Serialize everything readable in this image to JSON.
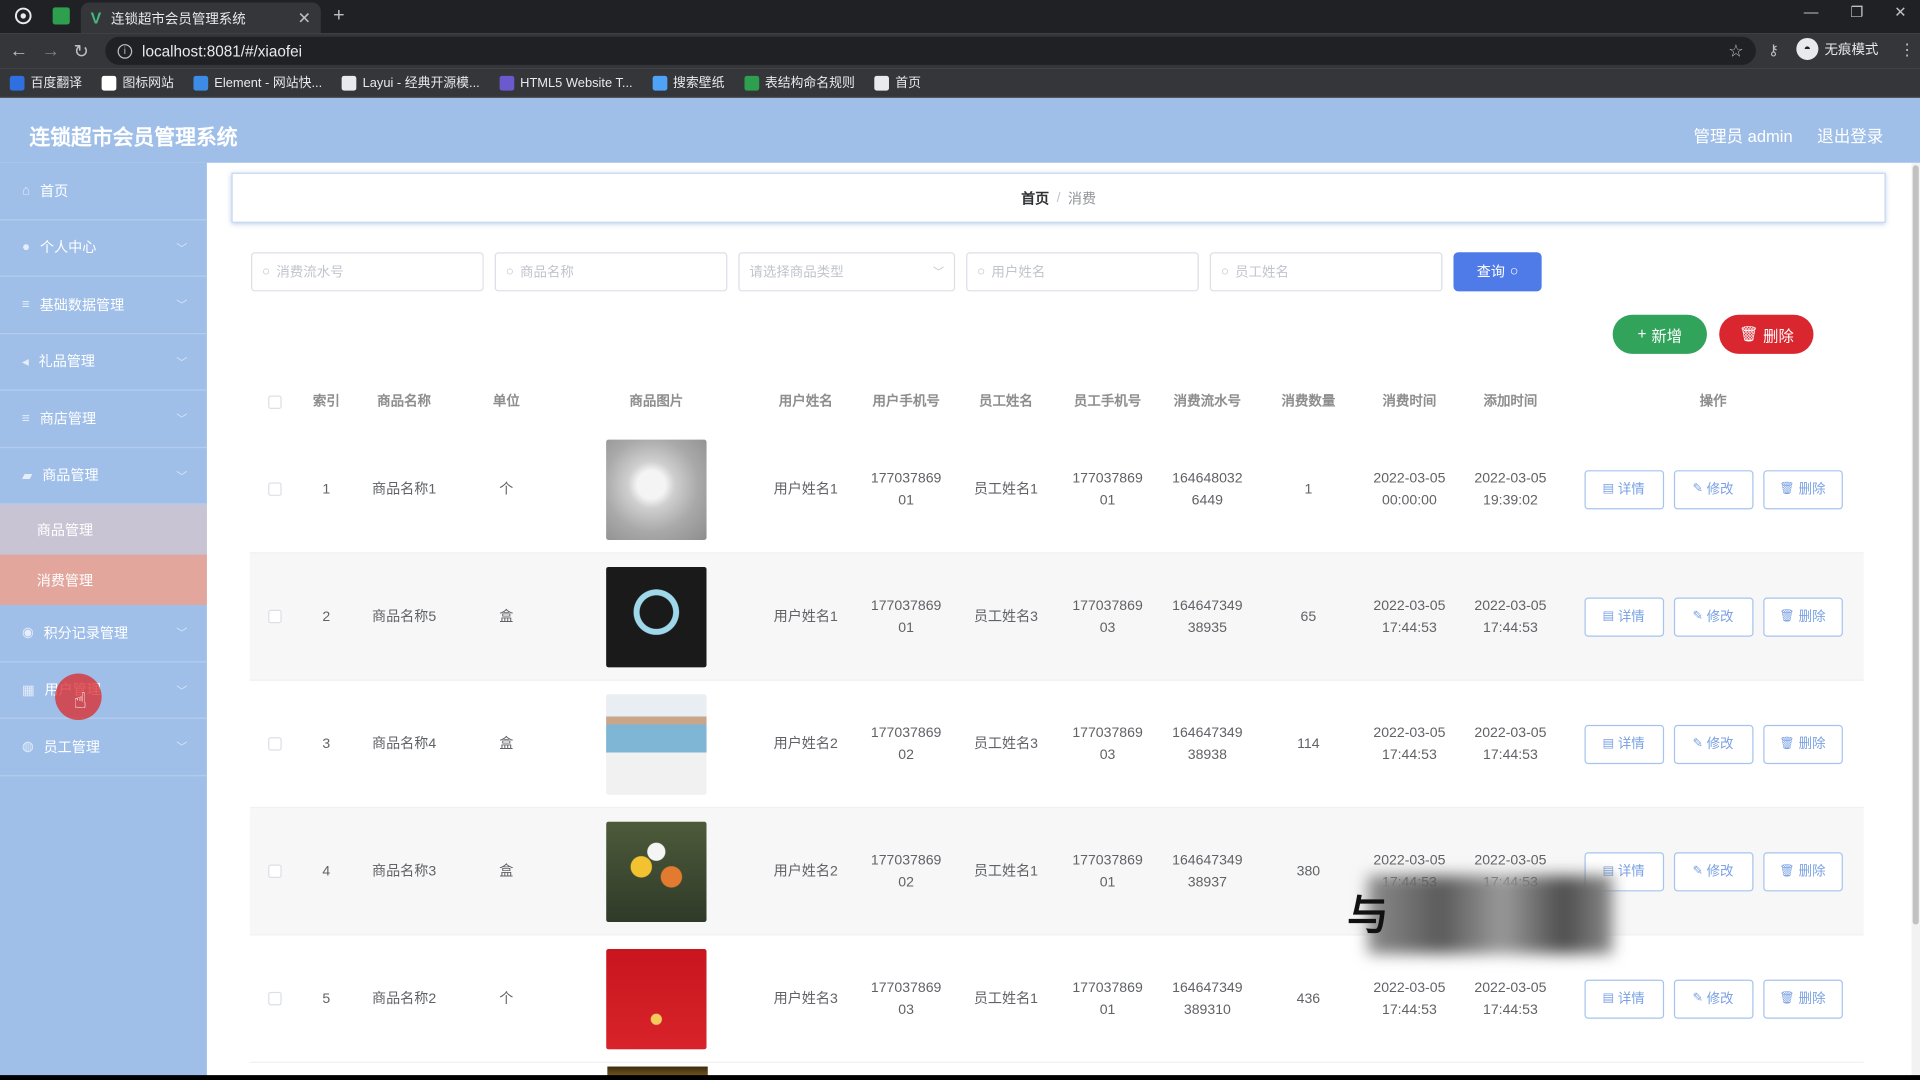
{
  "browser": {
    "tab_title": "连锁超市会员管理系统",
    "url": "localhost:8081/#/xiaofei",
    "incognito_label": "无痕模式",
    "bookmarks": [
      {
        "label": "百度翻译",
        "color": "#2f6fe0"
      },
      {
        "label": "图标网站",
        "color": "#ffffff"
      },
      {
        "label": "Element - 网站快...",
        "color": "#3c8ce7"
      },
      {
        "label": "Layui - 经典开源模...",
        "color": "#e8eaed"
      },
      {
        "label": "HTML5 Website T...",
        "color": "#6a5acd"
      },
      {
        "label": "搜索壁纸",
        "color": "#4fa3f7"
      },
      {
        "label": "表结构命名规则",
        "color": "#2e9e4f"
      },
      {
        "label": "首页",
        "color": "#e8eaed"
      }
    ]
  },
  "header": {
    "brand": "连锁超市会员管理系统",
    "admin": "管理员 admin",
    "logout": "退出登录"
  },
  "sidebar": {
    "items": [
      {
        "label": "首页",
        "icon": "home-icon",
        "has_arrow": false
      },
      {
        "label": "个人中心",
        "icon": "user-icon",
        "has_arrow": true
      },
      {
        "label": "基础数据管理",
        "icon": "list-icon",
        "has_arrow": true
      },
      {
        "label": "礼品管理",
        "icon": "gift-icon",
        "has_arrow": true
      },
      {
        "label": "商店管理",
        "icon": "list-icon",
        "has_arrow": true
      },
      {
        "label": "商品管理",
        "icon": "box-icon",
        "has_arrow": true
      }
    ],
    "sub_items": [
      {
        "label": "商品管理",
        "active": false
      },
      {
        "label": "消费管理",
        "active": true
      }
    ],
    "items_after": [
      {
        "label": "积分记录管理",
        "icon": "medal-icon",
        "has_arrow": true
      },
      {
        "label": "用户管理",
        "icon": "grid-icon",
        "has_arrow": true
      },
      {
        "label": "员工管理",
        "icon": "circle-icon",
        "has_arrow": true
      }
    ]
  },
  "breadcrumb": {
    "home": "首页",
    "sep": "/",
    "current": "消费"
  },
  "search": {
    "serial_placeholder": "消费流水号",
    "product_placeholder": "商品名称",
    "type_placeholder": "请选择商品类型",
    "user_placeholder": "用户姓名",
    "employee_placeholder": "员工姓名",
    "query_label": "查询"
  },
  "actions": {
    "add_label": "新增",
    "delete_label": "删除"
  },
  "table": {
    "headers": {
      "index": "索引",
      "name": "商品名称",
      "unit": "单位",
      "image": "商品图片",
      "uname": "用户姓名",
      "uphone": "用户手机号",
      "ename": "员工姓名",
      "ephone": "员工手机号",
      "serial": "消费流水号",
      "qty": "消费数量",
      "time": "消费时间",
      "add": "添加时间",
      "ops": "操作"
    },
    "op_labels": {
      "detail": "详情",
      "edit": "修改",
      "delete": "删除"
    },
    "rows": [
      {
        "index": "1",
        "name": "商品名称1",
        "unit": "个",
        "img": "img-silver",
        "uname": "用户姓名1",
        "uphone": [
          "177037869",
          "01"
        ],
        "ename": "员工姓名1",
        "ephone": [
          "177037869",
          "01"
        ],
        "serial": [
          "164648032",
          "6449"
        ],
        "qty": "1",
        "time": [
          "2022-03-05",
          "00:00:00"
        ],
        "add": [
          "2022-03-05",
          "19:39:02"
        ]
      },
      {
        "index": "2",
        "name": "商品名称5",
        "unit": "盒",
        "img": "img-necklace",
        "uname": "用户姓名1",
        "uphone": [
          "177037869",
          "01"
        ],
        "ename": "员工姓名3",
        "ephone": [
          "177037869",
          "03"
        ],
        "serial": [
          "164647349",
          "38935"
        ],
        "qty": "65",
        "time": [
          "2022-03-05",
          "17:44:53"
        ],
        "add": [
          "2022-03-05",
          "17:44:53"
        ]
      },
      {
        "index": "3",
        "name": "商品名称4",
        "unit": "盒",
        "img": "img-fashion",
        "uname": "用户姓名2",
        "uphone": [
          "177037869",
          "02"
        ],
        "ename": "员工姓名3",
        "ephone": [
          "177037869",
          "03"
        ],
        "serial": [
          "164647349",
          "38938"
        ],
        "qty": "114",
        "time": [
          "2022-03-05",
          "17:44:53"
        ],
        "add": [
          "2022-03-05",
          "17:44:53"
        ]
      },
      {
        "index": "4",
        "name": "商品名称3",
        "unit": "盒",
        "img": "img-flowers",
        "uname": "用户姓名2",
        "uphone": [
          "177037869",
          "02"
        ],
        "ename": "员工姓名1",
        "ephone": [
          "177037869",
          "01"
        ],
        "serial": [
          "164647349",
          "38937"
        ],
        "qty": "380",
        "time": [
          "2022-03-05",
          "17:44:53"
        ],
        "add": [
          "2022-03-05",
          "17:44:53"
        ]
      },
      {
        "index": "5",
        "name": "商品名称2",
        "unit": "个",
        "img": "img-gold",
        "uname": "用户姓名3",
        "uphone": [
          "177037869",
          "03"
        ],
        "ename": "员工姓名1",
        "ephone": [
          "177037869",
          "01"
        ],
        "serial": [
          "164647349",
          "389310"
        ],
        "qty": "436",
        "time": [
          "2022-03-05",
          "17:44:53"
        ],
        "add": [
          "2022-03-05",
          "17:44:53"
        ]
      }
    ]
  }
}
